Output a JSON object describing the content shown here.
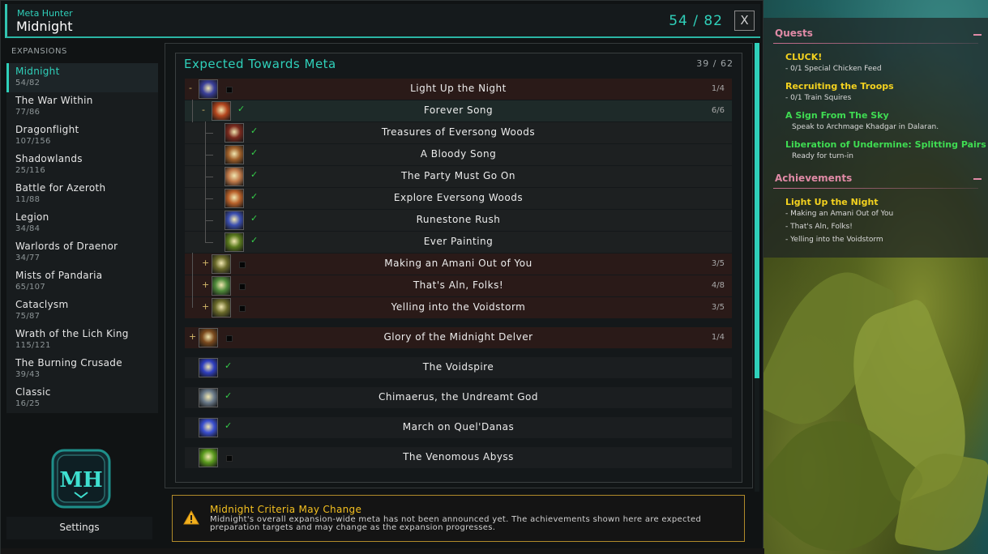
{
  "window": {
    "app_name": "Meta Hunter",
    "expansion_title": "Midnight",
    "total_progress": "54 / 82",
    "close_label": "X"
  },
  "sidebar": {
    "section_label": "EXPANSIONS",
    "items": [
      {
        "name": "Midnight",
        "count": "54/82"
      },
      {
        "name": "The War Within",
        "count": "77/86"
      },
      {
        "name": "Dragonflight",
        "count": "107/156"
      },
      {
        "name": "Shadowlands",
        "count": "25/116"
      },
      {
        "name": "Battle for Azeroth",
        "count": "11/88"
      },
      {
        "name": "Legion",
        "count": "34/84"
      },
      {
        "name": "Warlords of Draenor",
        "count": "34/77"
      },
      {
        "name": "Mists of Pandaria",
        "count": "65/107"
      },
      {
        "name": "Cataclysm",
        "count": "75/87"
      },
      {
        "name": "Wrath of the Lich King",
        "count": "115/121"
      },
      {
        "name": "The Burning Crusade",
        "count": "39/43"
      },
      {
        "name": "Classic",
        "count": "16/25"
      }
    ],
    "logo_text": "MH",
    "settings_label": "Settings"
  },
  "panel": {
    "title": "Expected Towards Meta",
    "count": "39 / 62",
    "rows": [
      {
        "toggle": "-",
        "name": "Light Up the Night",
        "count": "1/4",
        "done": false,
        "icon_color": "#3a3f9a"
      },
      {
        "toggle": "-",
        "name": "Forever Song",
        "count": "6/6",
        "done": true,
        "icon_color": "#b3461e"
      },
      {
        "name": "Treasures of Eversong Woods",
        "done": true,
        "icon_color": "#7a2a1e"
      },
      {
        "name": "A Bloody Song",
        "done": true,
        "icon_color": "#a0602a"
      },
      {
        "name": "The Party Must Go On",
        "done": true,
        "icon_color": "#c07a4a"
      },
      {
        "name": "Explore Eversong Woods",
        "done": true,
        "icon_color": "#b8612a"
      },
      {
        "name": "Runestone Rush",
        "done": true,
        "icon_color": "#3b4fb0"
      },
      {
        "name": "Ever Painting",
        "done": true,
        "icon_color": "#5a7a1e"
      },
      {
        "toggle": "+",
        "name": "Making an Amani Out of You",
        "count": "3/5",
        "done": false,
        "icon_color": "#6a6a2a"
      },
      {
        "toggle": "+",
        "name": "That's Aln, Folks!",
        "count": "4/8",
        "done": false,
        "icon_color": "#4f8a3a"
      },
      {
        "toggle": "+",
        "name": "Yelling into the Voidstorm",
        "count": "3/5",
        "done": false,
        "icon_color": "#6a6a2a"
      },
      {
        "toggle": "+",
        "name": "Glory of the Midnight Delver",
        "count": "1/4",
        "done": false,
        "icon_color": "#7a4a1e"
      },
      {
        "name": "The Voidspire",
        "done": true,
        "icon_color": "#2f3fc0"
      },
      {
        "name": "Chimaerus, the Undreamt God",
        "done": true,
        "icon_color": "#6a7a8a"
      },
      {
        "name": "March on Quel'Danas",
        "done": true,
        "icon_color": "#3a4fd0"
      },
      {
        "name": "The Venomous Abyss",
        "done": false,
        "icon_color": "#5a9a1e"
      }
    ]
  },
  "warning": {
    "title": "Midnight Criteria May Change",
    "body": "Midnight's overall expansion-wide meta has not been announced yet. The achievements shown here are expected preparation targets and may change as the expansion progresses.",
    "icon": "warning-triangle-icon"
  },
  "tracker": {
    "quests_header": "Quests",
    "quests": [
      {
        "title": "CLUCK!",
        "line": "- 0/1 Special Chicken Feed",
        "color": "yellow"
      },
      {
        "title": "Recruiting the Troops",
        "line": "- 0/1 Train Squires",
        "color": "yellow"
      },
      {
        "title": "A Sign From The Sky",
        "line": "Speak to Archmage Khadgar in Dalaran.",
        "color": "green"
      },
      {
        "title": "Liberation of Undermine: Splitting Pairs",
        "line": "Ready for turn-in",
        "color": "green"
      }
    ],
    "achievements_header": "Achievements",
    "achievement_title": "Light Up the Night",
    "achievement_lines": [
      "- Making an Amani Out of You",
      "- That's Aln, Folks!",
      "- Yelling into the Voidstorm"
    ]
  },
  "colors": {
    "accent": "#2fd0ba",
    "warning": "#f4c020",
    "quest_yellow": "#f4d21f",
    "quest_green": "#3fdc52",
    "tracker_header": "#e08aa6"
  }
}
